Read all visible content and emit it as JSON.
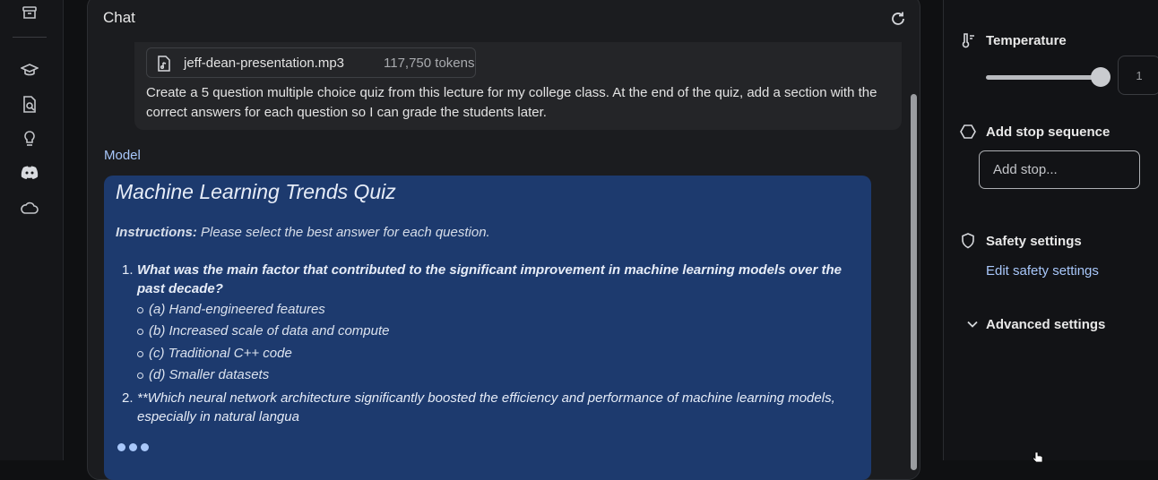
{
  "sidebar": {
    "icons": [
      "archive-icon",
      "school-icon",
      "document-search-icon",
      "lightbulb-icon",
      "discord-icon",
      "cloud-icon"
    ]
  },
  "chat": {
    "title": "Chat",
    "user_message": {
      "file_name": "jeff-dean-presentation.mp3",
      "file_tokens": "117,750 tokens",
      "prompt": "Create a 5 question multiple choice quiz from this lecture for my college class. At the end of the quiz, add a section with the correct answers for each question so I can grade the students later."
    },
    "model_label": "Model",
    "response": {
      "title": "Machine Learning Trends Quiz",
      "instructions_label": "Instructions:",
      "instructions_text": "Please select the best answer for each question.",
      "q1_num": "1.",
      "q1_text": "What was the main factor that contributed to the significant improvement in machine learning models over the past decade?",
      "q1_options": [
        "(a) Hand-engineered features",
        "(b) Increased scale of data and compute",
        "(c) Traditional C++ code",
        "(d) Smaller datasets"
      ],
      "q2_num": "2.",
      "q2_text": "**Which neural network architecture significantly boosted the efficiency and performance of machine learning models, especially in natural langua"
    }
  },
  "settings": {
    "temperature_label": "Temperature",
    "temperature_value": "1",
    "temperature_fraction": 1.0,
    "stop_label": "Add stop sequence",
    "stop_placeholder": "Add stop...",
    "safety_label": "Safety settings",
    "safety_link": "Edit safety settings",
    "advanced_label": "Advanced settings"
  },
  "colors": {
    "background": "#0f1012",
    "response_bg": "#1d3a6e",
    "accent_link": "#a8c7fa"
  }
}
